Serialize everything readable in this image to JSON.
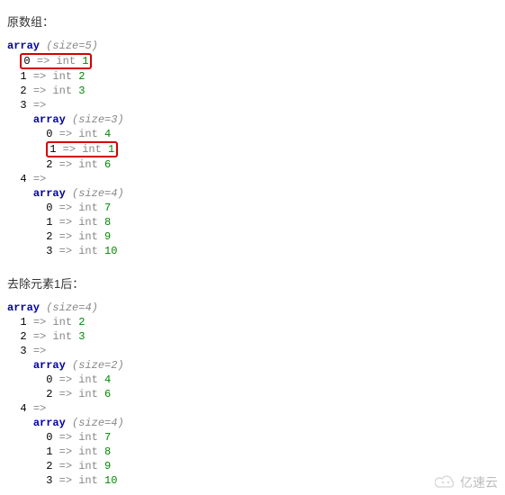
{
  "heading_before": "原数组：",
  "heading_after": "去除元素1后：",
  "kw_array": "array",
  "type_int": "int",
  "arrow": "=>",
  "before": {
    "size": "5",
    "rows": [
      {
        "idx": "0",
        "val": "1",
        "highlight": true
      },
      {
        "idx": "1",
        "val": "2"
      },
      {
        "idx": "2",
        "val": "3"
      },
      {
        "idx": "3",
        "sub": {
          "size": "3",
          "rows": [
            {
              "idx": "0",
              "val": "4"
            },
            {
              "idx": "1",
              "val": "1",
              "highlight": true
            },
            {
              "idx": "2",
              "val": "6"
            }
          ]
        }
      },
      {
        "idx": "4",
        "sub": {
          "size": "4",
          "rows": [
            {
              "idx": "0",
              "val": "7"
            },
            {
              "idx": "1",
              "val": "8"
            },
            {
              "idx": "2",
              "val": "9"
            },
            {
              "idx": "3",
              "val": "10"
            }
          ]
        }
      }
    ]
  },
  "after": {
    "size": "4",
    "rows": [
      {
        "idx": "1",
        "val": "2"
      },
      {
        "idx": "2",
        "val": "3"
      },
      {
        "idx": "3",
        "sub": {
          "size": "2",
          "rows": [
            {
              "idx": "0",
              "val": "4"
            },
            {
              "idx": "2",
              "val": "6"
            }
          ]
        }
      },
      {
        "idx": "4",
        "sub": {
          "size": "4",
          "rows": [
            {
              "idx": "0",
              "val": "7"
            },
            {
              "idx": "1",
              "val": "8"
            },
            {
              "idx": "2",
              "val": "9"
            },
            {
              "idx": "3",
              "val": "10"
            }
          ]
        }
      }
    ]
  },
  "watermark_text": "亿速云"
}
